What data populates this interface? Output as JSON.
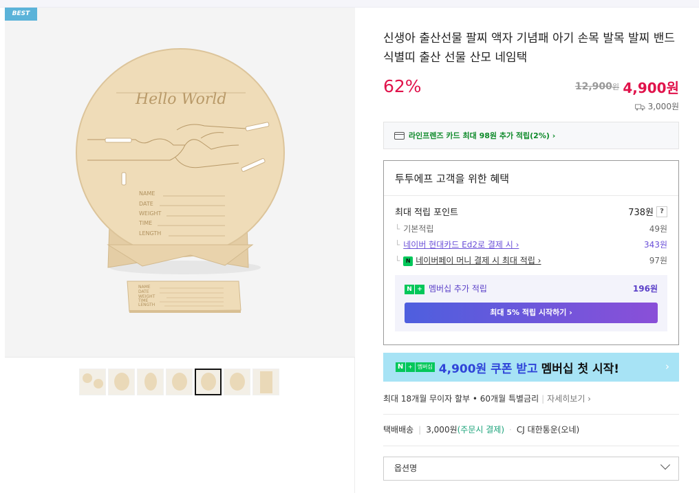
{
  "badge": "BEST",
  "product": {
    "title": "신생아 출산선물 팔찌 액자 기념패 아기 손목 발목 발찌 밴드 식별띠 출산 선물 산모 네임택",
    "discount": "62%",
    "original_price": "12,900",
    "original_unit": "원",
    "sale_price": "4,900원",
    "shipping_fee": "3,000원"
  },
  "image_text": {
    "script": "Hello World",
    "fields": [
      "NAME",
      "DATE",
      "WEIGHT",
      "TIME",
      "LENGTH"
    ]
  },
  "card_promo": "라인프렌즈 카드 최대 98원 추가 적립(2%) ›",
  "benefit": {
    "title": "투투에프 고객을 위한 혜택",
    "max_points_label": "최대 적립 포인트",
    "max_points_value": "738원",
    "help": "?",
    "rows": [
      {
        "label": "기본적립",
        "value": "49원"
      },
      {
        "label": "네이버 현대카드 Ed2로 결제 시 ›",
        "value": "343원"
      },
      {
        "label": "네이버페이 머니 결제 시 최대 적립 ›",
        "value": "97원"
      }
    ],
    "npay_icon": "N",
    "membership_label": "멤버십 추가 적립",
    "membership_value": "196원",
    "membership_btn": "최대 5% 적립 시작하기 ›"
  },
  "coupon_banner": {
    "tag_n": "N",
    "tag_plus": "+",
    "tag_label": "멤버십",
    "text1": "4,900원 쿠폰 받고",
    "text2": "멤버십 첫 시작!",
    "arrow": "›"
  },
  "installment": {
    "text": "최대 18개월 무이자 할부 • 60개월 특별금리",
    "sep": "|",
    "detail": "자세히보기 ›"
  },
  "delivery": {
    "type": "택배배송",
    "sep": "|",
    "fee": "3,000원",
    "fee_note": "(주문시 결제)",
    "dot": "·",
    "courier": "CJ 대한통운(오네)"
  },
  "option_label": "옵션명",
  "colors": {
    "sale": "#e0134b",
    "green": "#0e8a2a",
    "naver": "#03c75a",
    "purple": "#6a4fd8",
    "banner": "#a7e3f5"
  },
  "icons": [
    "card-icon",
    "truck-icon",
    "npay-icon",
    "naver-plus-icon",
    "chevron-down-icon",
    "chevron-right-icon"
  ]
}
